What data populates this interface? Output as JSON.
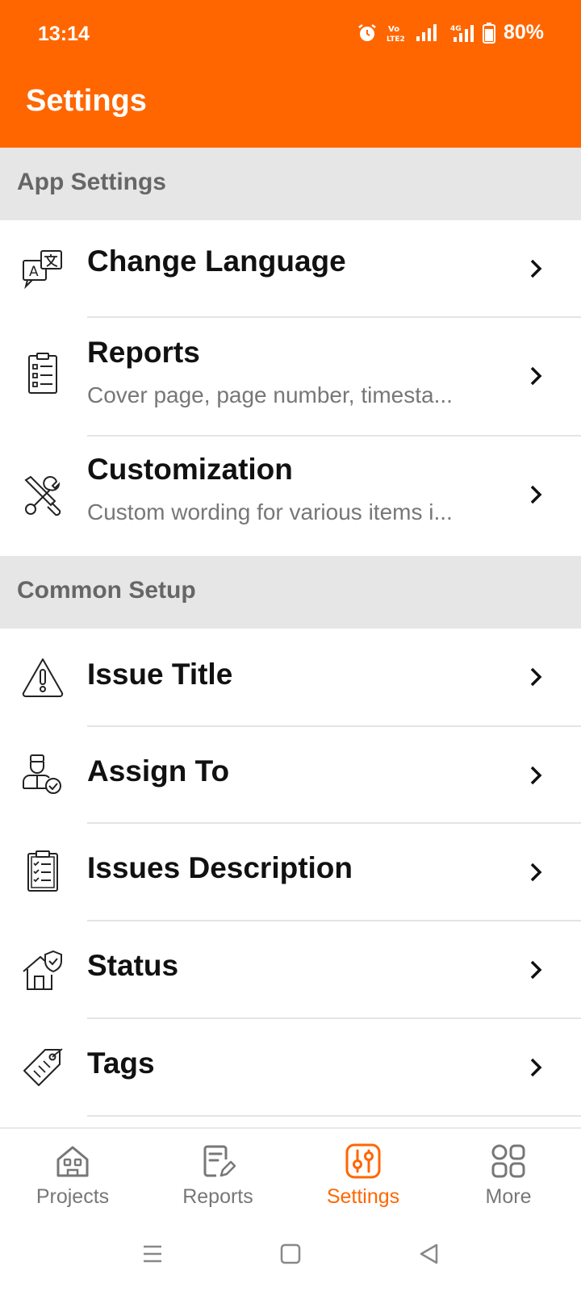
{
  "status_bar": {
    "time": "13:14",
    "battery": "80%",
    "icons": [
      "alarm-icon",
      "volte-icon",
      "signal-icon",
      "4g-signal-icon",
      "battery-icon"
    ]
  },
  "header": {
    "title": "Settings",
    "background_color": "#FF6600"
  },
  "sections": [
    {
      "label": "App Settings",
      "items": [
        {
          "title": "Change Language",
          "subtitle": "",
          "icon": "translate-icon"
        },
        {
          "title": "Reports",
          "subtitle": "Cover page, page number, timesta...",
          "icon": "clipboard-list-icon"
        },
        {
          "title": "Customization",
          "subtitle": "Custom wording for various items i...",
          "icon": "tools-icon"
        }
      ]
    },
    {
      "label": "Common Setup",
      "items": [
        {
          "title": "Issue Title",
          "subtitle": "",
          "icon": "warning-icon"
        },
        {
          "title": "Assign To",
          "subtitle": "",
          "icon": "user-check-icon"
        },
        {
          "title": "Issues Description",
          "subtitle": "",
          "icon": "checklist-icon"
        },
        {
          "title": "Status",
          "subtitle": "",
          "icon": "house-shield-icon"
        },
        {
          "title": "Tags",
          "subtitle": "",
          "icon": "tag-icon"
        }
      ]
    }
  ],
  "bottom_nav": {
    "items": [
      {
        "label": "Projects",
        "icon": "home-icon",
        "active": false
      },
      {
        "label": "Reports",
        "icon": "report-edit-icon",
        "active": false
      },
      {
        "label": "Settings",
        "icon": "sliders-icon",
        "active": true
      },
      {
        "label": "More",
        "icon": "grid-icon",
        "active": false
      }
    ],
    "active_color": "#FF6600"
  },
  "system_nav": [
    "menu-icon",
    "home-square-icon",
    "back-triangle-icon"
  ]
}
